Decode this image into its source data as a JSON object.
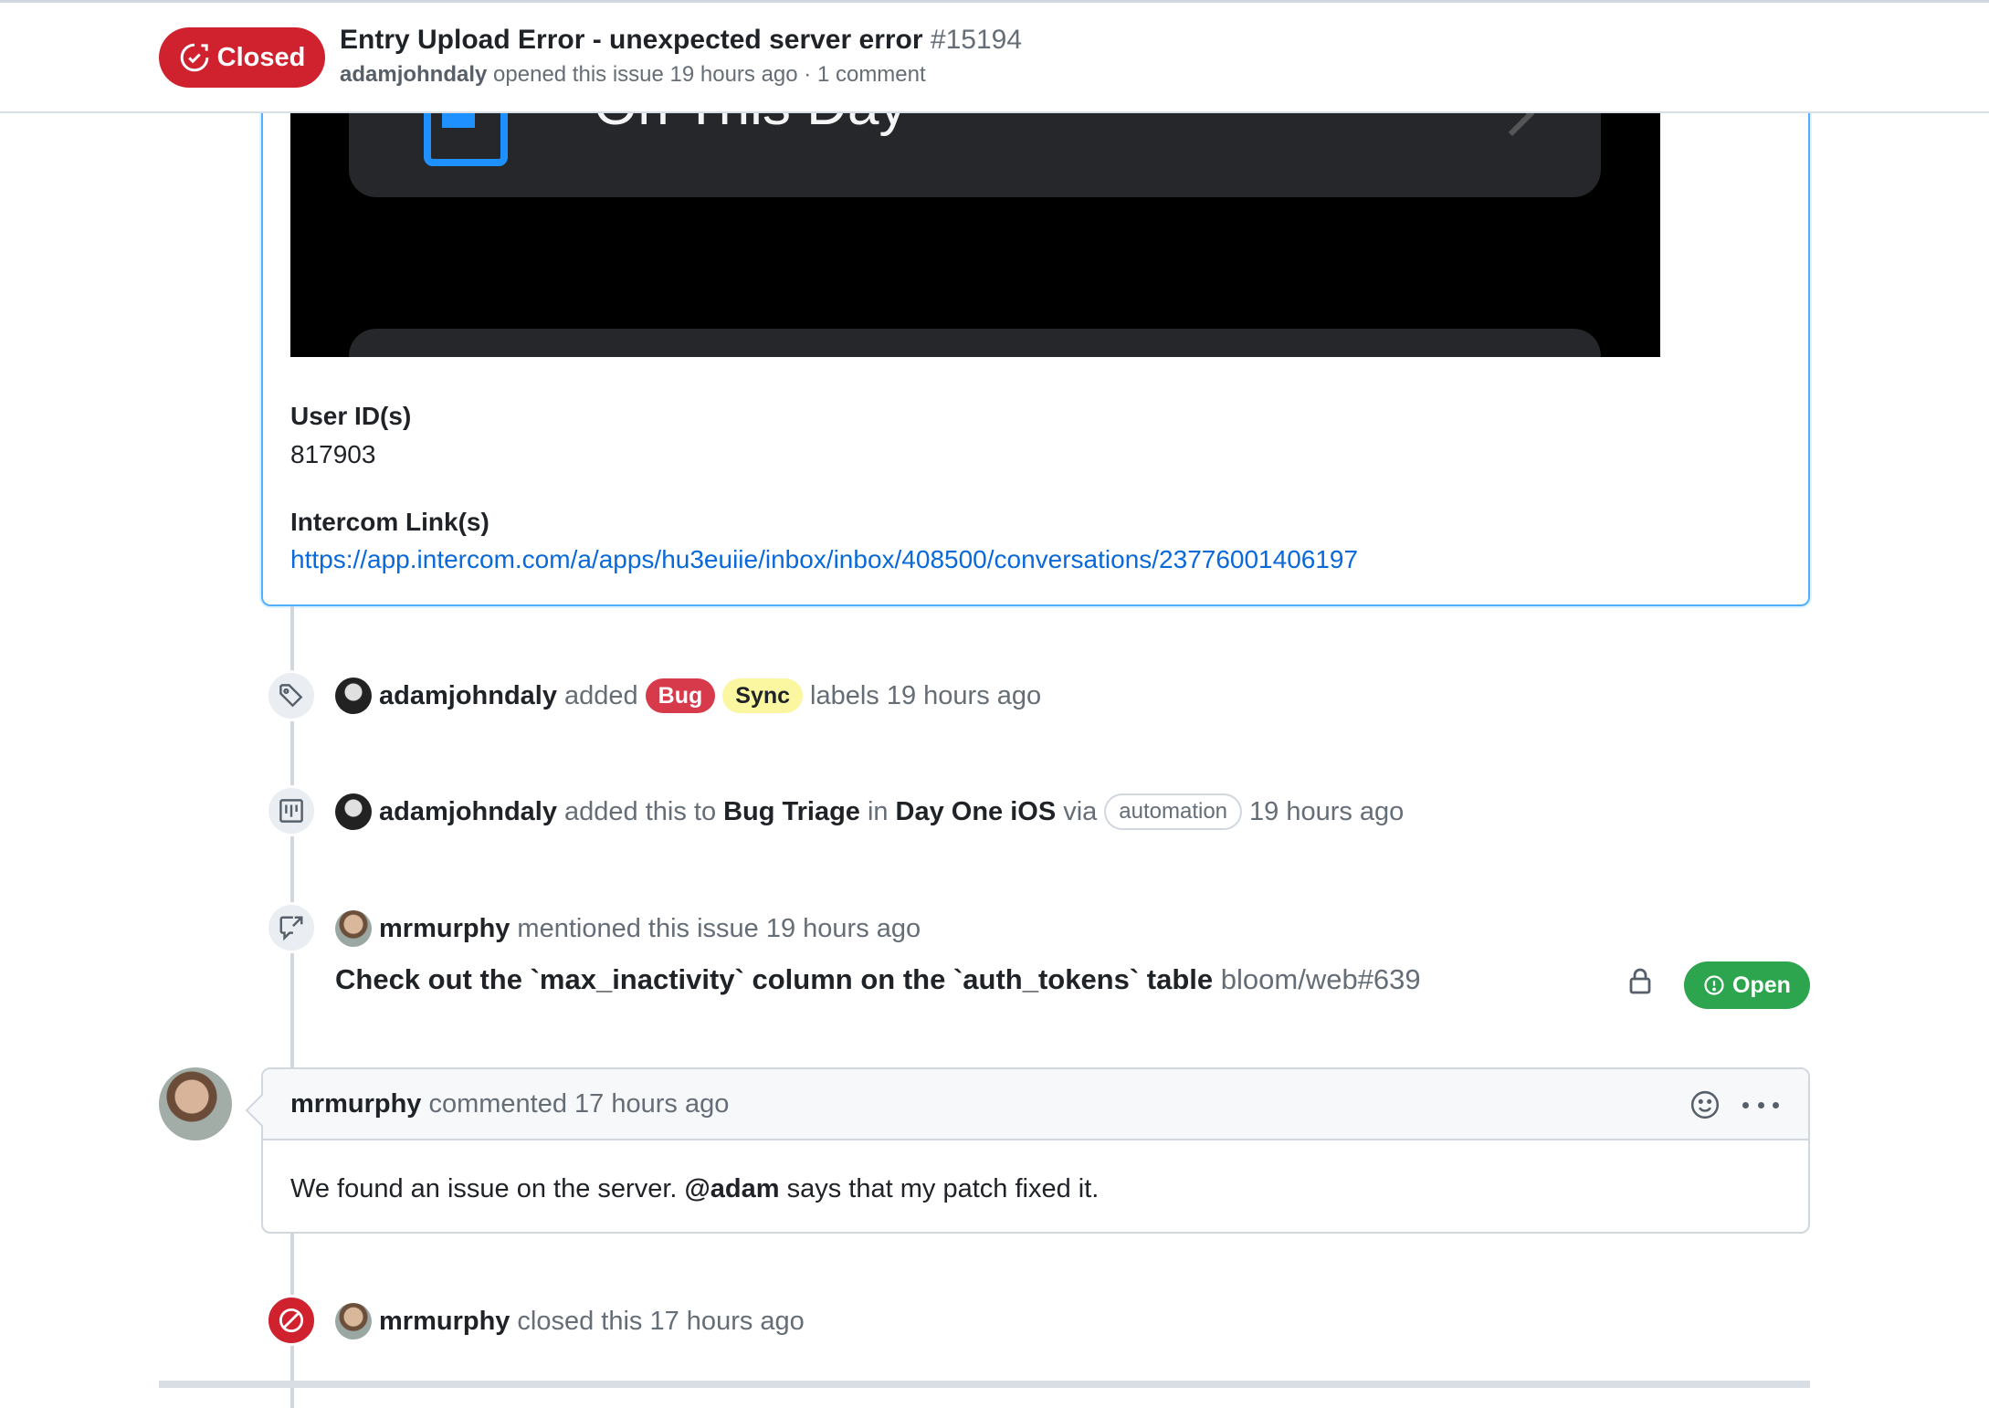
{
  "header": {
    "status": "Closed",
    "title": "Entry Upload Error - unexpected server error",
    "number": "#15194",
    "author": "adamjohndaly",
    "meta_rest": "opened this issue 19 hours ago · 1 comment"
  },
  "body": {
    "screenshot_text": "On This Day",
    "user_ids_label": "User ID(s)",
    "user_ids_value": "817903",
    "intercom_label": "Intercom Link(s)",
    "intercom_link": "https://app.intercom.com/a/apps/hu3euiie/inbox/inbox/408500/conversations/23776001406197"
  },
  "events": {
    "labels": {
      "actor": "adamjohndaly",
      "verb": "added",
      "label1": "Bug",
      "label2": "Sync",
      "suffix": "labels 19 hours ago",
      "icon": "tag-icon"
    },
    "project": {
      "actor": "adamjohndaly",
      "verb": "added this to",
      "project": "Bug Triage",
      "in": "in",
      "board": "Day One iOS",
      "via": "via",
      "automation": "automation",
      "time": "19 hours ago",
      "icon": "project-icon"
    },
    "mention": {
      "actor": "mrmurphy",
      "text": "mentioned this issue 19 hours ago",
      "ref_title": "Check out the `max_inactivity` column on the `auth_tokens` table",
      "ref_repo": "bloom/web#639",
      "ref_status": "Open",
      "icon": "cross-reference-icon"
    },
    "closed": {
      "actor": "mrmurphy",
      "text": "closed this 17 hours ago",
      "icon": "circle-slash-icon"
    }
  },
  "comment": {
    "author": "mrmurphy",
    "meta": "commented 17 hours ago",
    "body_before": "We found an issue on the server.",
    "mention": "@adam",
    "body_after": "says that my patch fixed it."
  },
  "colors": {
    "closed_red": "#cf222e",
    "open_green": "#2da44e",
    "link_blue": "#0969da",
    "bug_label": "#d73a4a",
    "sync_label": "#fbf7a0"
  }
}
